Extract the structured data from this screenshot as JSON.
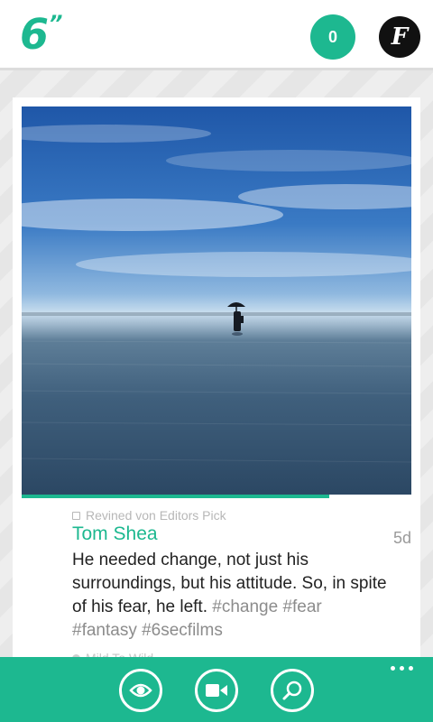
{
  "header": {
    "logo_text": "6",
    "logo_quote": "”",
    "notification_count": "0",
    "avatar_initial": "F"
  },
  "post": {
    "revined_text": "Revined von Editors Pick",
    "author": "Tom Shea",
    "age": "5d",
    "caption_text": "He needed change, not just his surroundings, but his attitude. So, in spite of his fear, he left.",
    "hashtags": [
      "#change",
      "#fear",
      "#fantasy",
      "#6secfilms"
    ],
    "location": "Mild To Wild",
    "video_progress": 0.79
  },
  "appbar": {
    "buttons": [
      "watch-icon",
      "record-video-icon",
      "search-icon"
    ],
    "more_icon": "more-dots-icon"
  },
  "colors": {
    "accent": "#1db890",
    "header_bg": "#ffffff",
    "text": "#222222",
    "hashtag": "#8c8c8c",
    "muted": "#b7b7b7"
  }
}
